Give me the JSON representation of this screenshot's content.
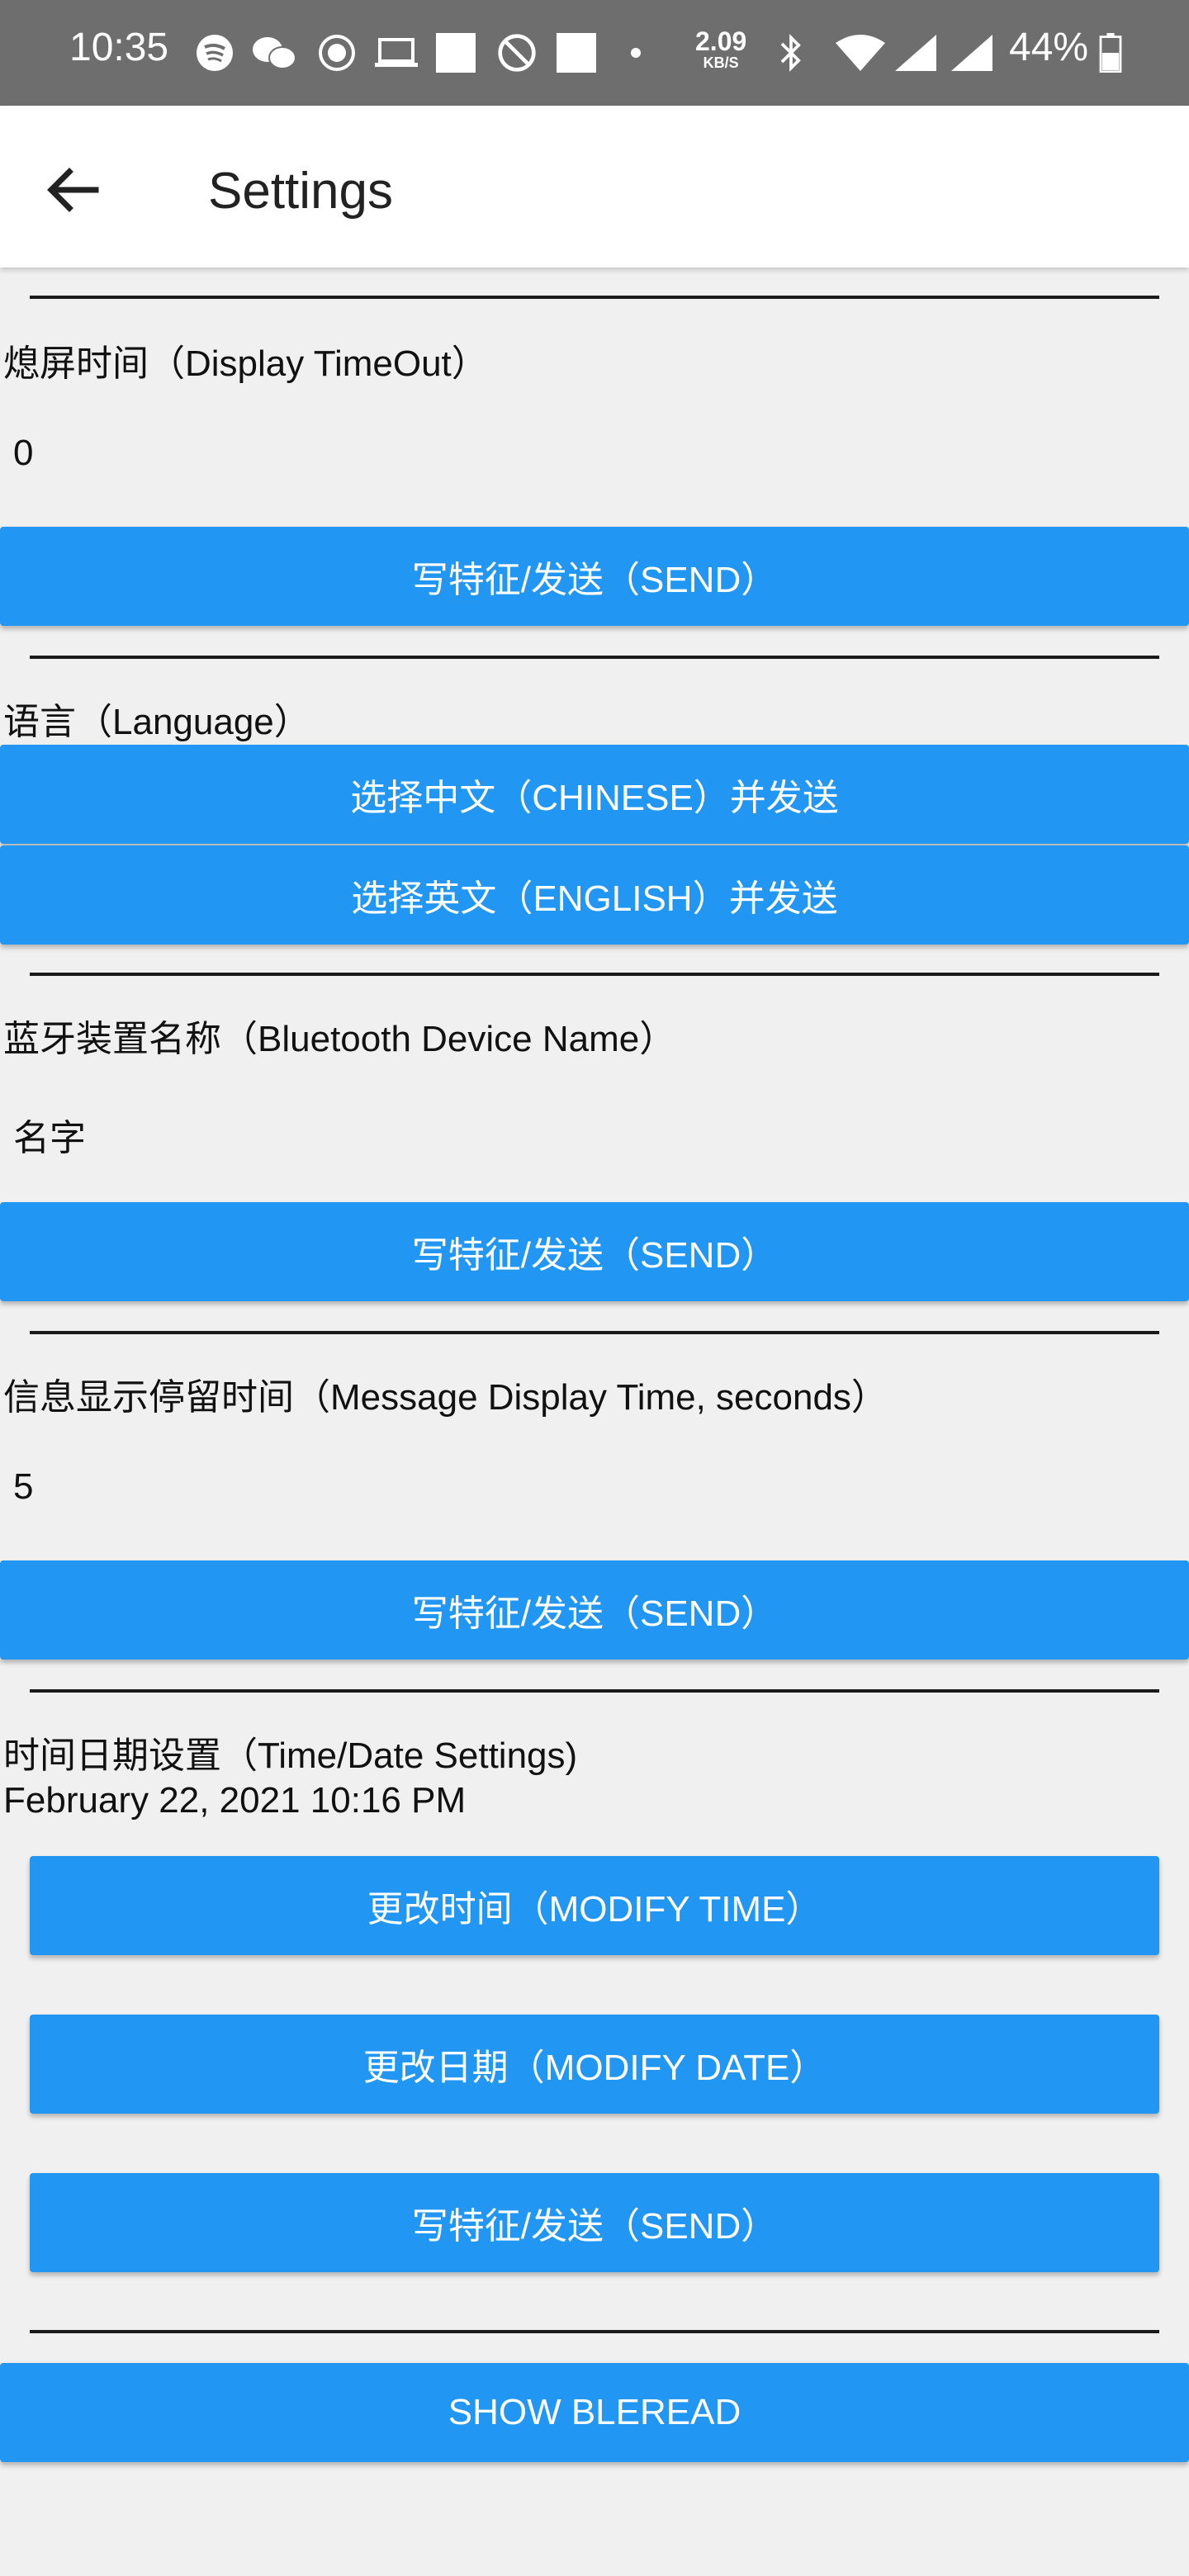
{
  "status_bar": {
    "time": "10:35",
    "speed_value": "2.09",
    "speed_unit": "KB/S",
    "battery": "44%"
  },
  "app_bar": {
    "title": "Settings"
  },
  "display_timeout": {
    "label": "熄屏时间（Display TimeOut）",
    "value": "0",
    "send_button": "写特征/发送（SEND）"
  },
  "language": {
    "label": "语言（Language）",
    "chinese_button": "选择中文（CHINESE）并发送",
    "english_button": "选择英文（ENGLISH）并发送"
  },
  "device_name": {
    "label": "蓝牙装置名称（Bluetooth Device Name）",
    "value": "名字",
    "send_button": "写特征/发送（SEND）"
  },
  "message_time": {
    "label": "信息显示停留时间（Message Display Time, seconds）",
    "value": "5",
    "send_button": "写特征/发送（SEND）"
  },
  "time_date": {
    "label": "时间日期设置（Time/Date Settings)",
    "current": "February 22, 2021 10:16 PM",
    "modify_time_button": "更改时间（MODIFY TIME）",
    "modify_date_button": "更改日期（MODIFY DATE）",
    "send_button": "写特征/发送（SEND）"
  },
  "show_bleread_button": "SHOW BLEREAD"
}
